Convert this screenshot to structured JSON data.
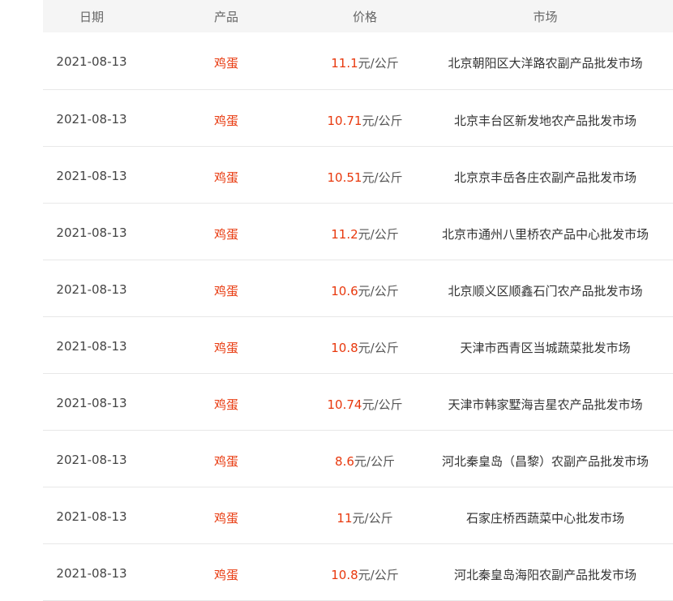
{
  "columns": {
    "date": "日期",
    "product": "产品",
    "price": "价格",
    "market": "市场"
  },
  "rows": [
    {
      "date": "2021-08-13",
      "product": "鸡蛋",
      "price": "11.1",
      "unit": "元/公斤",
      "market": "北京朝阳区大洋路农副产品批发市场"
    },
    {
      "date": "2021-08-13",
      "product": "鸡蛋",
      "price": "10.71",
      "unit": "元/公斤",
      "market": "北京丰台区新发地农产品批发市场"
    },
    {
      "date": "2021-08-13",
      "product": "鸡蛋",
      "price": "10.51",
      "unit": "元/公斤",
      "market": "北京京丰岳各庄农副产品批发市场"
    },
    {
      "date": "2021-08-13",
      "product": "鸡蛋",
      "price": "11.2",
      "unit": "元/公斤",
      "market": "北京市通州八里桥农产品中心批发市场"
    },
    {
      "date": "2021-08-13",
      "product": "鸡蛋",
      "price": "10.6",
      "unit": "元/公斤",
      "market": "北京顺义区顺鑫石门农产品批发市场"
    },
    {
      "date": "2021-08-13",
      "product": "鸡蛋",
      "price": "10.8",
      "unit": "元/公斤",
      "market": "天津市西青区当城蔬菜批发市场"
    },
    {
      "date": "2021-08-13",
      "product": "鸡蛋",
      "price": "10.74",
      "unit": "元/公斤",
      "market": "天津市韩家墅海吉星农产品批发市场"
    },
    {
      "date": "2021-08-13",
      "product": "鸡蛋",
      "price": "8.6",
      "unit": "元/公斤",
      "market": "河北秦皇岛（昌黎）农副产品批发市场"
    },
    {
      "date": "2021-08-13",
      "product": "鸡蛋",
      "price": "11",
      "unit": "元/公斤",
      "market": "石家庄桥西蔬菜中心批发市场"
    },
    {
      "date": "2021-08-13",
      "product": "鸡蛋",
      "price": "10.8",
      "unit": "元/公斤",
      "market": "河北秦皇岛海阳农副产品批发市场"
    }
  ],
  "colors": {
    "accent": "#e8380d",
    "header_bg": "#f5f5f5",
    "divider": "#e8e8e8"
  }
}
